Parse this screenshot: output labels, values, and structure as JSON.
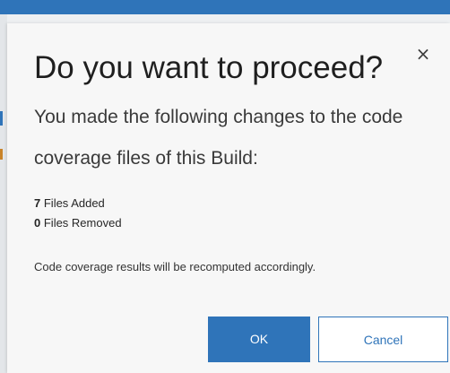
{
  "dialog": {
    "title": "Do you want to proceed?",
    "close_glyph": "×",
    "message": "You made the following changes to the code coverage files of this Build:",
    "stats": [
      {
        "count": "7",
        "label": "Files Added"
      },
      {
        "count": "0",
        "label": "Files Removed"
      }
    ],
    "note": "Code coverage results will be recomputed accordingly.",
    "ok_label": "OK",
    "cancel_label": "Cancel"
  },
  "icons": {
    "close": "close-icon"
  },
  "colors": {
    "accent": "#2f74b9",
    "dialog_background": "#f7f7f7",
    "text": "#262626"
  }
}
